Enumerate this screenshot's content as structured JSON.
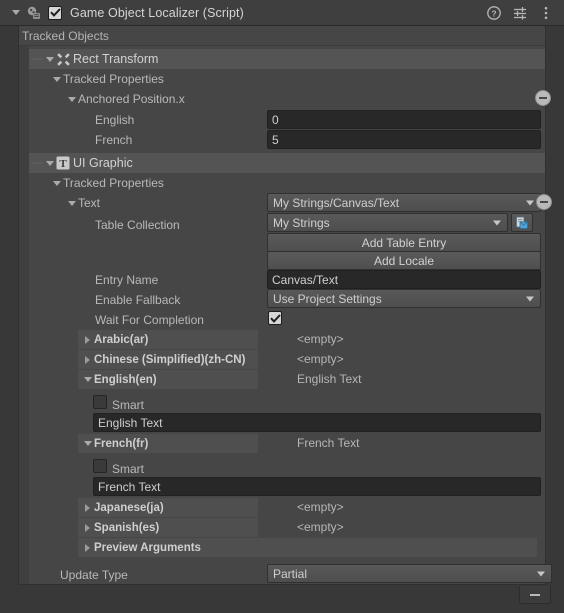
{
  "header": {
    "title": "Game Object Localizer (Script)",
    "enabled": true,
    "script_icon": "script-icon",
    "help_icon": "help-icon",
    "preset_icon": "preset-icon",
    "menu_icon": "more-menu-icon"
  },
  "panel": {
    "title": "Tracked Objects"
  },
  "rect_transform": {
    "name": "Rect Transform",
    "icon": "rect-transform-icon",
    "tracked_properties_label": "Tracked Properties",
    "property_label": "Anchored Position.x",
    "locales": [
      {
        "label": "English",
        "value": "0"
      },
      {
        "label": "French",
        "value": "5"
      }
    ]
  },
  "ui_graphic": {
    "name": "UI Graphic",
    "icon": "text-component-icon",
    "tracked_properties_label": "Tracked Properties",
    "property_label": "Text",
    "string_reference": "My Strings/Canvas/Text",
    "table_collection_label": "Table Collection",
    "table_collection_value": "My Strings",
    "open_table_icon": "open-table-icon",
    "add_table_entry_label": "Add Table Entry",
    "add_locale_label": "Add Locale",
    "entry_name_label": "Entry Name",
    "entry_name_value": "Canvas/Text",
    "enable_fallback_label": "Enable Fallback",
    "enable_fallback_value": "Use Project Settings",
    "wait_for_completion_label": "Wait For Completion",
    "wait_for_completion_checked": true,
    "locales": [
      {
        "name": "Arabic(ar)",
        "expanded": false,
        "preview": "<empty>"
      },
      {
        "name": "Chinese (Simplified)(zh-CN)",
        "expanded": false,
        "preview": "<empty>"
      },
      {
        "name": "English(en)",
        "expanded": true,
        "preview": "English Text",
        "smart_label": "Smart",
        "smart_checked": false,
        "text_value": "English Text"
      },
      {
        "name": "French(fr)",
        "expanded": true,
        "preview": "French Text",
        "smart_label": "Smart",
        "smart_checked": false,
        "text_value": "French Text"
      },
      {
        "name": "Japanese(ja)",
        "expanded": false,
        "preview": "<empty>"
      },
      {
        "name": "Spanish(es)",
        "expanded": false,
        "preview": "<empty>"
      }
    ],
    "preview_arguments_label": "Preview Arguments",
    "update_type_label": "Update Type",
    "update_type_value": "Partial"
  },
  "footer": {
    "remove_label": "–"
  },
  "colors": {
    "window_bg": "#383838",
    "panel_bg": "#464646",
    "header_bg": "#3f3f3f",
    "section_bg": "#545454",
    "field_bg": "#282828",
    "text": "#c4c4c4",
    "accent_blue": "#5a9fd4"
  }
}
